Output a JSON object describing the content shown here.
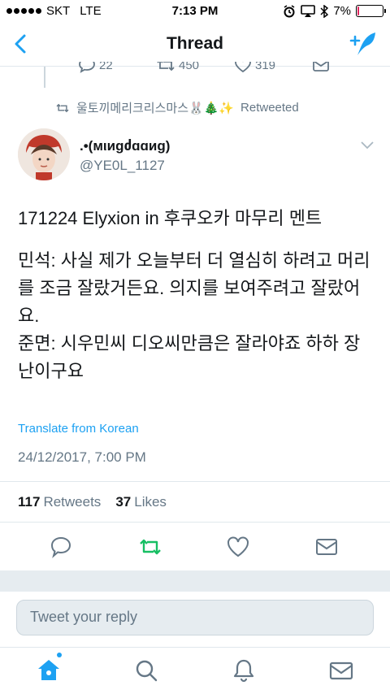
{
  "status": {
    "carrier": "SKT",
    "network": "LTE",
    "time": "7:13 PM",
    "battery": "7%",
    "battery_level": 0.07
  },
  "nav": {
    "title": "Thread",
    "back_icon": "back-arrow-icon",
    "compose_icon": "compose-tweet-icon"
  },
  "previous_tweet": {
    "replies": "22",
    "retweets": "450",
    "likes": "319"
  },
  "retweeted_by": {
    "name": "울토끼메리크리스마스🐰🎄✨",
    "suffix": "Retweeted"
  },
  "author": {
    "name": ".•(мιиgძɑɑиg)",
    "handle": "@YE0L_1127"
  },
  "tweet": {
    "line1": "171224 Elyxion in 후쿠오카 마무리 멘트",
    "body": "민석: 사실 제가 오늘부터 더 열심히 하려고 머리를 조금 잘랐거든요. 의지를 보여주려고 잘랐어요.",
    "body2": "준면: 시우민씨 디오씨만큼은 잘라야죠 하하 장난이구요",
    "translate": "Translate from Korean",
    "date": "24/12/2017, 7:00 PM"
  },
  "counts": {
    "retweets_num": "117",
    "retweets_label": "Retweets",
    "likes_num": "37",
    "likes_label": "Likes"
  },
  "reply": {
    "placeholder": "Tweet your reply"
  },
  "colors": {
    "accent": "#1da1f2",
    "retweet_green": "#17bf63",
    "muted": "#657786"
  }
}
